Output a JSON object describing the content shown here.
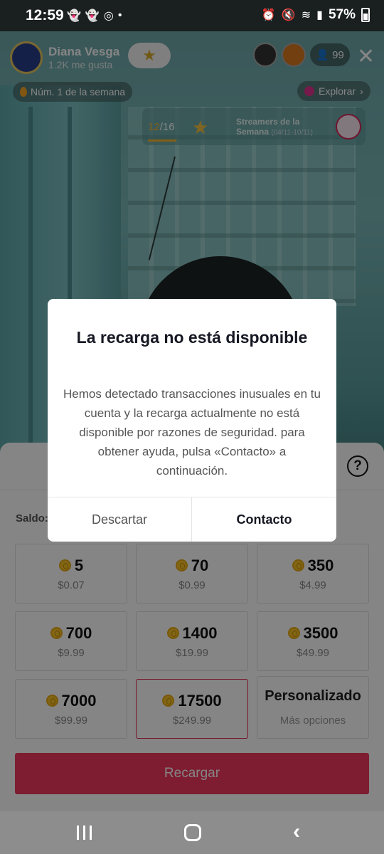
{
  "status_bar": {
    "time": "12:59",
    "left_icons": [
      "snapchat-icon",
      "snapchat-icon",
      "whatsapp-icon",
      "dot-icon"
    ],
    "right_icons": [
      "alarm-icon",
      "mute-icon",
      "wifi-icon",
      "signal-icon"
    ],
    "battery": "57%"
  },
  "live": {
    "host_name": "Diana Vesga",
    "host_likes": "1.2K me gusta",
    "viewer_count": "99",
    "rank_label": "Núm. 1 de la semana",
    "explore_label": "Explorar",
    "streamers": {
      "current": "12",
      "total": "/16",
      "label_line1": "Streamers de la",
      "label_line2": "Semana",
      "date_range": "(04/11-10/11)"
    }
  },
  "dialog": {
    "title": "La recarga no está disponible",
    "body": "Hemos detectado transacciones inusuales en tu cuenta y la recarga actualmente no está disponible por razones de seguridad. para obtener ayuda, pulsa «Contacto» a continuación.",
    "dismiss_label": "Descartar",
    "contact_label": "Contacto"
  },
  "recharge": {
    "balance_label": "Saldo:",
    "packages": [
      {
        "coins": "5",
        "price": "$0.07",
        "selected": false
      },
      {
        "coins": "70",
        "price": "$0.99",
        "selected": false
      },
      {
        "coins": "350",
        "price": "$4.99",
        "selected": false
      },
      {
        "coins": "700",
        "price": "$9.99",
        "selected": false
      },
      {
        "coins": "1400",
        "price": "$19.99",
        "selected": false
      },
      {
        "coins": "3500",
        "price": "$49.99",
        "selected": false
      },
      {
        "coins": "7000",
        "price": "$99.99",
        "selected": false
      },
      {
        "coins": "17500",
        "price": "$249.99",
        "selected": true
      }
    ],
    "custom_title": "Personalizado",
    "custom_sub": "Más opciones",
    "button_label": "Recargar",
    "accent_color": "#f2385f"
  }
}
